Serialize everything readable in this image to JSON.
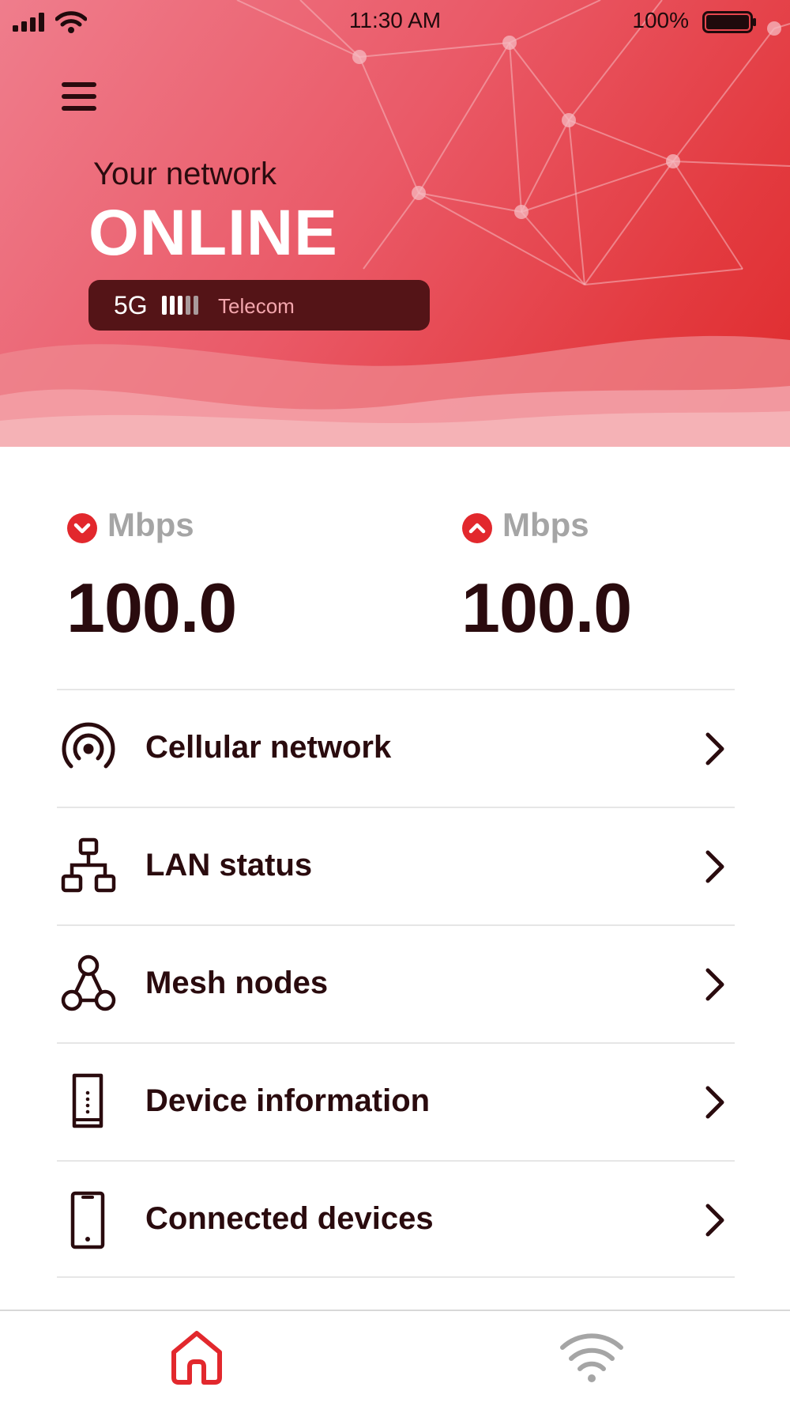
{
  "status_bar": {
    "time": "11:30 AM",
    "battery_percent": "100%",
    "signal_icon": "cellular-signal-icon",
    "wifi_icon": "wifi-icon",
    "battery_icon": "battery-full-icon"
  },
  "header": {
    "menu_icon": "hamburger-menu-icon",
    "network_label": "Your network",
    "network_status": "ONLINE",
    "carrier": {
      "technology": "5G",
      "signal_bars": 5,
      "signal_bars_filled": 3,
      "name": "Telecom"
    }
  },
  "speeds": {
    "download": {
      "icon": "download-arrow-icon",
      "unit": "Mbps",
      "value": "100.0"
    },
    "upload": {
      "icon": "upload-arrow-icon",
      "unit": "Mbps",
      "value": "100.0"
    }
  },
  "menu": [
    {
      "label": "Cellular network",
      "icon": "cellular-broadcast-icon"
    },
    {
      "label": "LAN status",
      "icon": "lan-network-icon"
    },
    {
      "label": "Mesh nodes",
      "icon": "mesh-nodes-icon"
    },
    {
      "label": "Device information",
      "icon": "router-device-icon"
    },
    {
      "label": "Connected devices",
      "icon": "smartphone-icon"
    }
  ],
  "tab_bar": {
    "items": [
      {
        "name": "home",
        "icon": "home-icon",
        "active": true
      },
      {
        "name": "wifi",
        "icon": "wifi-icon",
        "active": false
      }
    ]
  },
  "colors": {
    "accent": "#e2282d",
    "dark_text": "#2a0b0e",
    "muted": "#a5a5a5",
    "pill_bg": "#541417"
  }
}
